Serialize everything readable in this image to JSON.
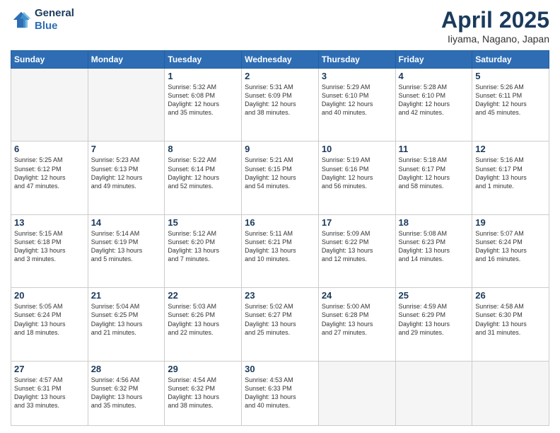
{
  "logo": {
    "line1": "General",
    "line2": "Blue"
  },
  "title": "April 2025",
  "location": "Iiyama, Nagano, Japan",
  "weekdays": [
    "Sunday",
    "Monday",
    "Tuesday",
    "Wednesday",
    "Thursday",
    "Friday",
    "Saturday"
  ],
  "weeks": [
    [
      {
        "day": "",
        "info": ""
      },
      {
        "day": "",
        "info": ""
      },
      {
        "day": "1",
        "info": "Sunrise: 5:32 AM\nSunset: 6:08 PM\nDaylight: 12 hours\nand 35 minutes."
      },
      {
        "day": "2",
        "info": "Sunrise: 5:31 AM\nSunset: 6:09 PM\nDaylight: 12 hours\nand 38 minutes."
      },
      {
        "day": "3",
        "info": "Sunrise: 5:29 AM\nSunset: 6:10 PM\nDaylight: 12 hours\nand 40 minutes."
      },
      {
        "day": "4",
        "info": "Sunrise: 5:28 AM\nSunset: 6:10 PM\nDaylight: 12 hours\nand 42 minutes."
      },
      {
        "day": "5",
        "info": "Sunrise: 5:26 AM\nSunset: 6:11 PM\nDaylight: 12 hours\nand 45 minutes."
      }
    ],
    [
      {
        "day": "6",
        "info": "Sunrise: 5:25 AM\nSunset: 6:12 PM\nDaylight: 12 hours\nand 47 minutes."
      },
      {
        "day": "7",
        "info": "Sunrise: 5:23 AM\nSunset: 6:13 PM\nDaylight: 12 hours\nand 49 minutes."
      },
      {
        "day": "8",
        "info": "Sunrise: 5:22 AM\nSunset: 6:14 PM\nDaylight: 12 hours\nand 52 minutes."
      },
      {
        "day": "9",
        "info": "Sunrise: 5:21 AM\nSunset: 6:15 PM\nDaylight: 12 hours\nand 54 minutes."
      },
      {
        "day": "10",
        "info": "Sunrise: 5:19 AM\nSunset: 6:16 PM\nDaylight: 12 hours\nand 56 minutes."
      },
      {
        "day": "11",
        "info": "Sunrise: 5:18 AM\nSunset: 6:17 PM\nDaylight: 12 hours\nand 58 minutes."
      },
      {
        "day": "12",
        "info": "Sunrise: 5:16 AM\nSunset: 6:17 PM\nDaylight: 13 hours\nand 1 minute."
      }
    ],
    [
      {
        "day": "13",
        "info": "Sunrise: 5:15 AM\nSunset: 6:18 PM\nDaylight: 13 hours\nand 3 minutes."
      },
      {
        "day": "14",
        "info": "Sunrise: 5:14 AM\nSunset: 6:19 PM\nDaylight: 13 hours\nand 5 minutes."
      },
      {
        "day": "15",
        "info": "Sunrise: 5:12 AM\nSunset: 6:20 PM\nDaylight: 13 hours\nand 7 minutes."
      },
      {
        "day": "16",
        "info": "Sunrise: 5:11 AM\nSunset: 6:21 PM\nDaylight: 13 hours\nand 10 minutes."
      },
      {
        "day": "17",
        "info": "Sunrise: 5:09 AM\nSunset: 6:22 PM\nDaylight: 13 hours\nand 12 minutes."
      },
      {
        "day": "18",
        "info": "Sunrise: 5:08 AM\nSunset: 6:23 PM\nDaylight: 13 hours\nand 14 minutes."
      },
      {
        "day": "19",
        "info": "Sunrise: 5:07 AM\nSunset: 6:24 PM\nDaylight: 13 hours\nand 16 minutes."
      }
    ],
    [
      {
        "day": "20",
        "info": "Sunrise: 5:05 AM\nSunset: 6:24 PM\nDaylight: 13 hours\nand 18 minutes."
      },
      {
        "day": "21",
        "info": "Sunrise: 5:04 AM\nSunset: 6:25 PM\nDaylight: 13 hours\nand 21 minutes."
      },
      {
        "day": "22",
        "info": "Sunrise: 5:03 AM\nSunset: 6:26 PM\nDaylight: 13 hours\nand 22 minutes."
      },
      {
        "day": "23",
        "info": "Sunrise: 5:02 AM\nSunset: 6:27 PM\nDaylight: 13 hours\nand 25 minutes."
      },
      {
        "day": "24",
        "info": "Sunrise: 5:00 AM\nSunset: 6:28 PM\nDaylight: 13 hours\nand 27 minutes."
      },
      {
        "day": "25",
        "info": "Sunrise: 4:59 AM\nSunset: 6:29 PM\nDaylight: 13 hours\nand 29 minutes."
      },
      {
        "day": "26",
        "info": "Sunrise: 4:58 AM\nSunset: 6:30 PM\nDaylight: 13 hours\nand 31 minutes."
      }
    ],
    [
      {
        "day": "27",
        "info": "Sunrise: 4:57 AM\nSunset: 6:31 PM\nDaylight: 13 hours\nand 33 minutes."
      },
      {
        "day": "28",
        "info": "Sunrise: 4:56 AM\nSunset: 6:32 PM\nDaylight: 13 hours\nand 35 minutes."
      },
      {
        "day": "29",
        "info": "Sunrise: 4:54 AM\nSunset: 6:32 PM\nDaylight: 13 hours\nand 38 minutes."
      },
      {
        "day": "30",
        "info": "Sunrise: 4:53 AM\nSunset: 6:33 PM\nDaylight: 13 hours\nand 40 minutes."
      },
      {
        "day": "",
        "info": ""
      },
      {
        "day": "",
        "info": ""
      },
      {
        "day": "",
        "info": ""
      }
    ]
  ]
}
